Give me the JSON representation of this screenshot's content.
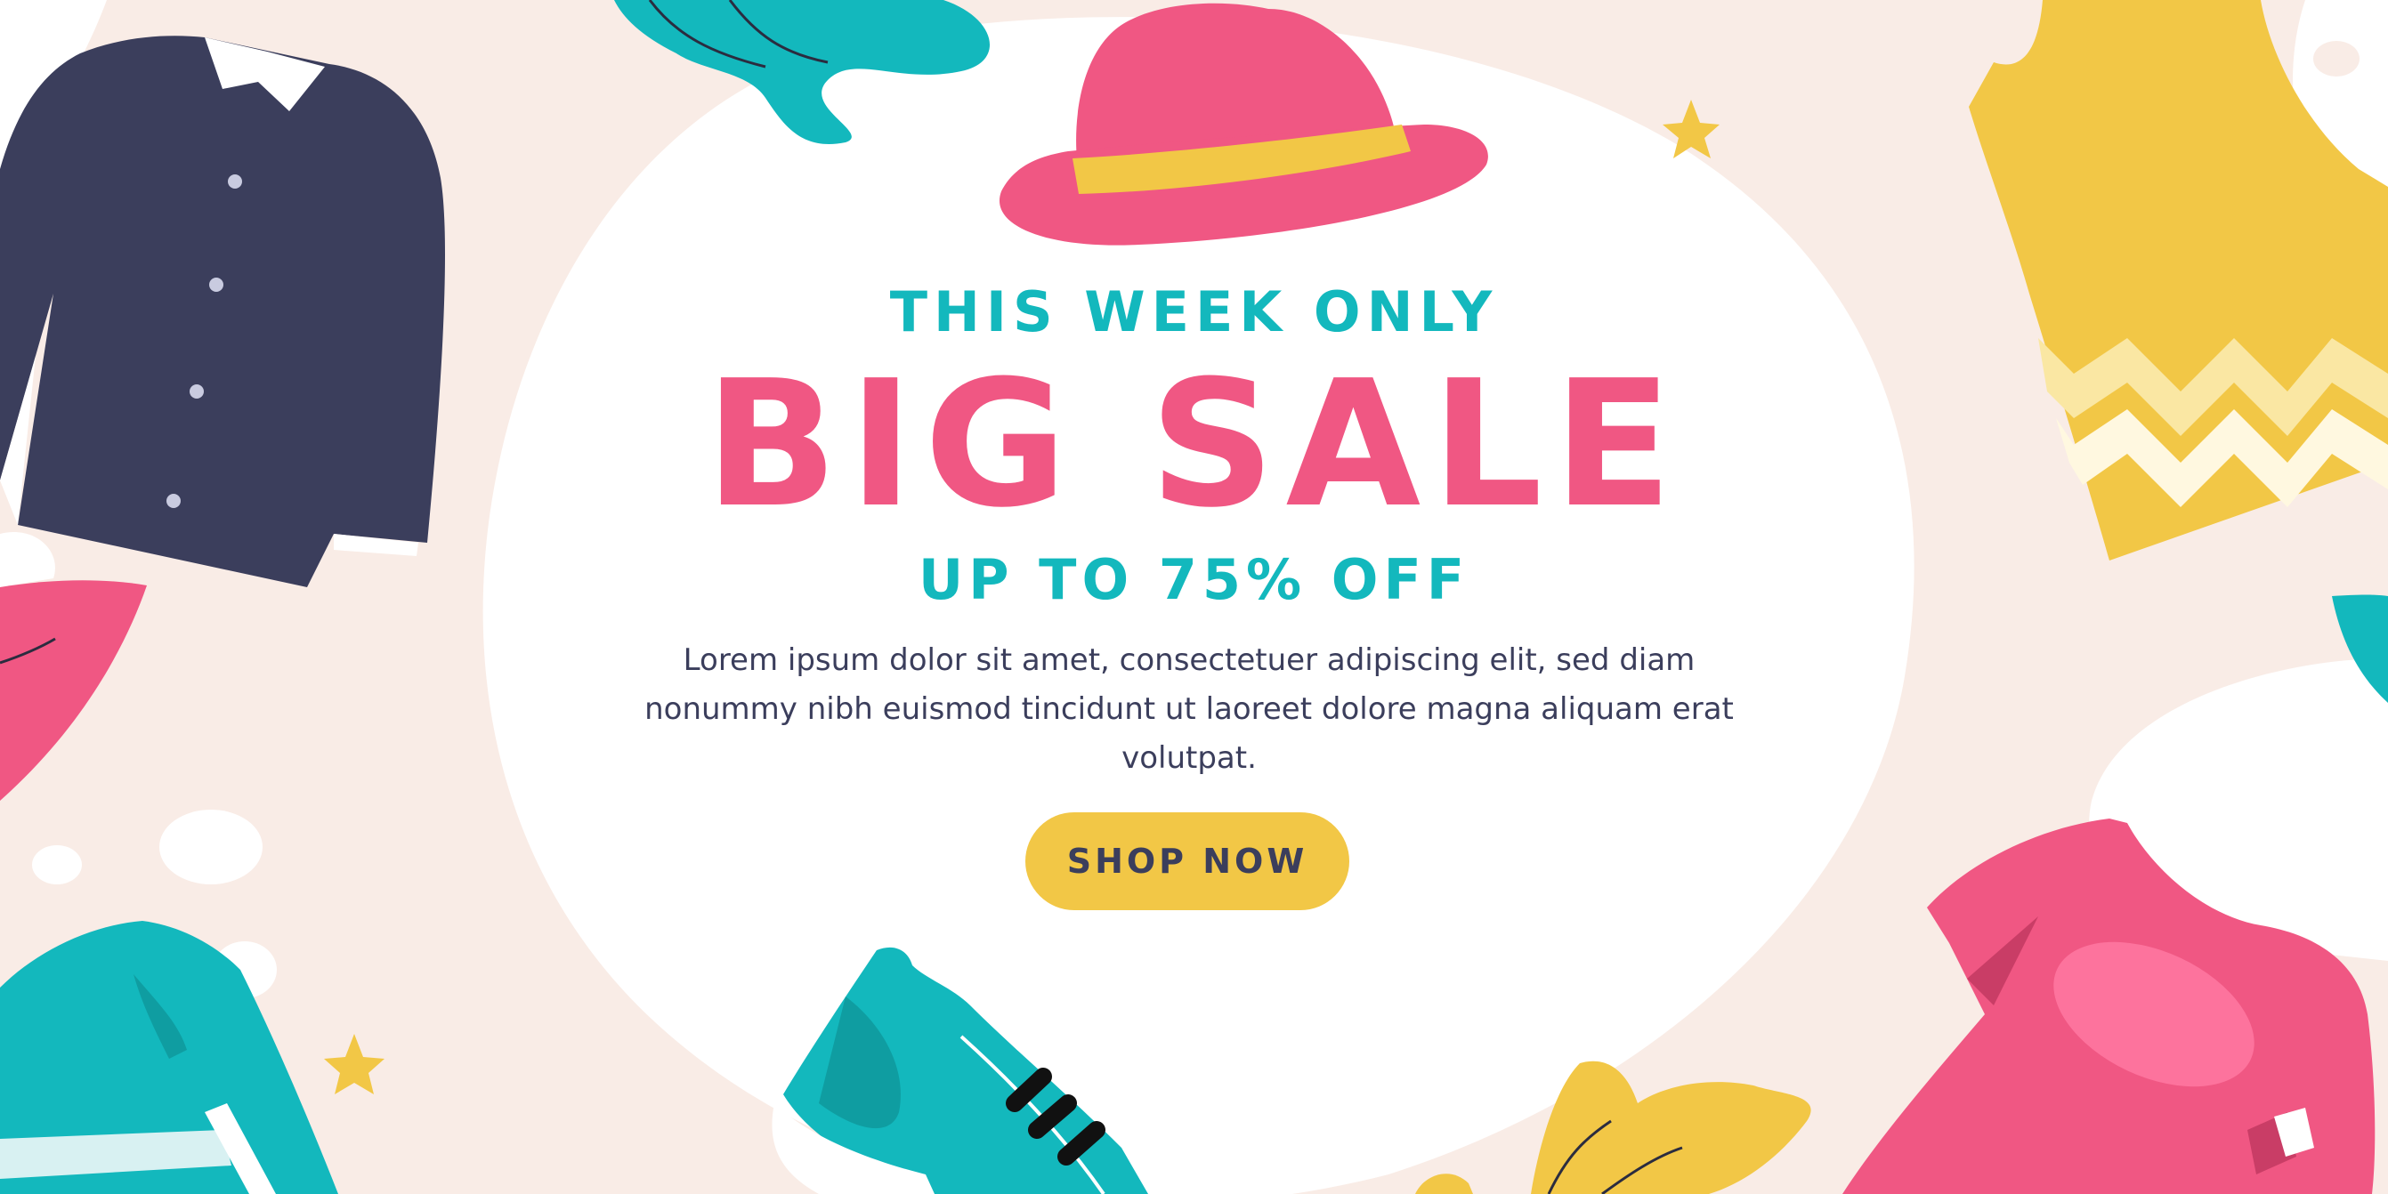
{
  "banner": {
    "eyebrow": "THIS WEEK ONLY",
    "headline": "BIG SALE",
    "discount": "UP TO 75% OFF",
    "body": "Lorem ipsum dolor sit amet, consectetuer adipiscing elit, sed diam nonummy nibh euismod tincidunt ut laoreet dolore magna aliquam erat volutpat.",
    "cta_label": "SHOP NOW"
  },
  "illustrations": [
    "shirt-icon",
    "hat-icon",
    "tank-top-icon",
    "sweater-icon",
    "sneaker-icon",
    "t-shirt-icon",
    "leaf-icon",
    "star-icon"
  ],
  "colors": {
    "background": "#f9ece6",
    "panel": "#ffffff",
    "pink": "#f05783",
    "teal": "#13b8bd",
    "yellow": "#f2c746",
    "navy": "#3b3e5c"
  }
}
